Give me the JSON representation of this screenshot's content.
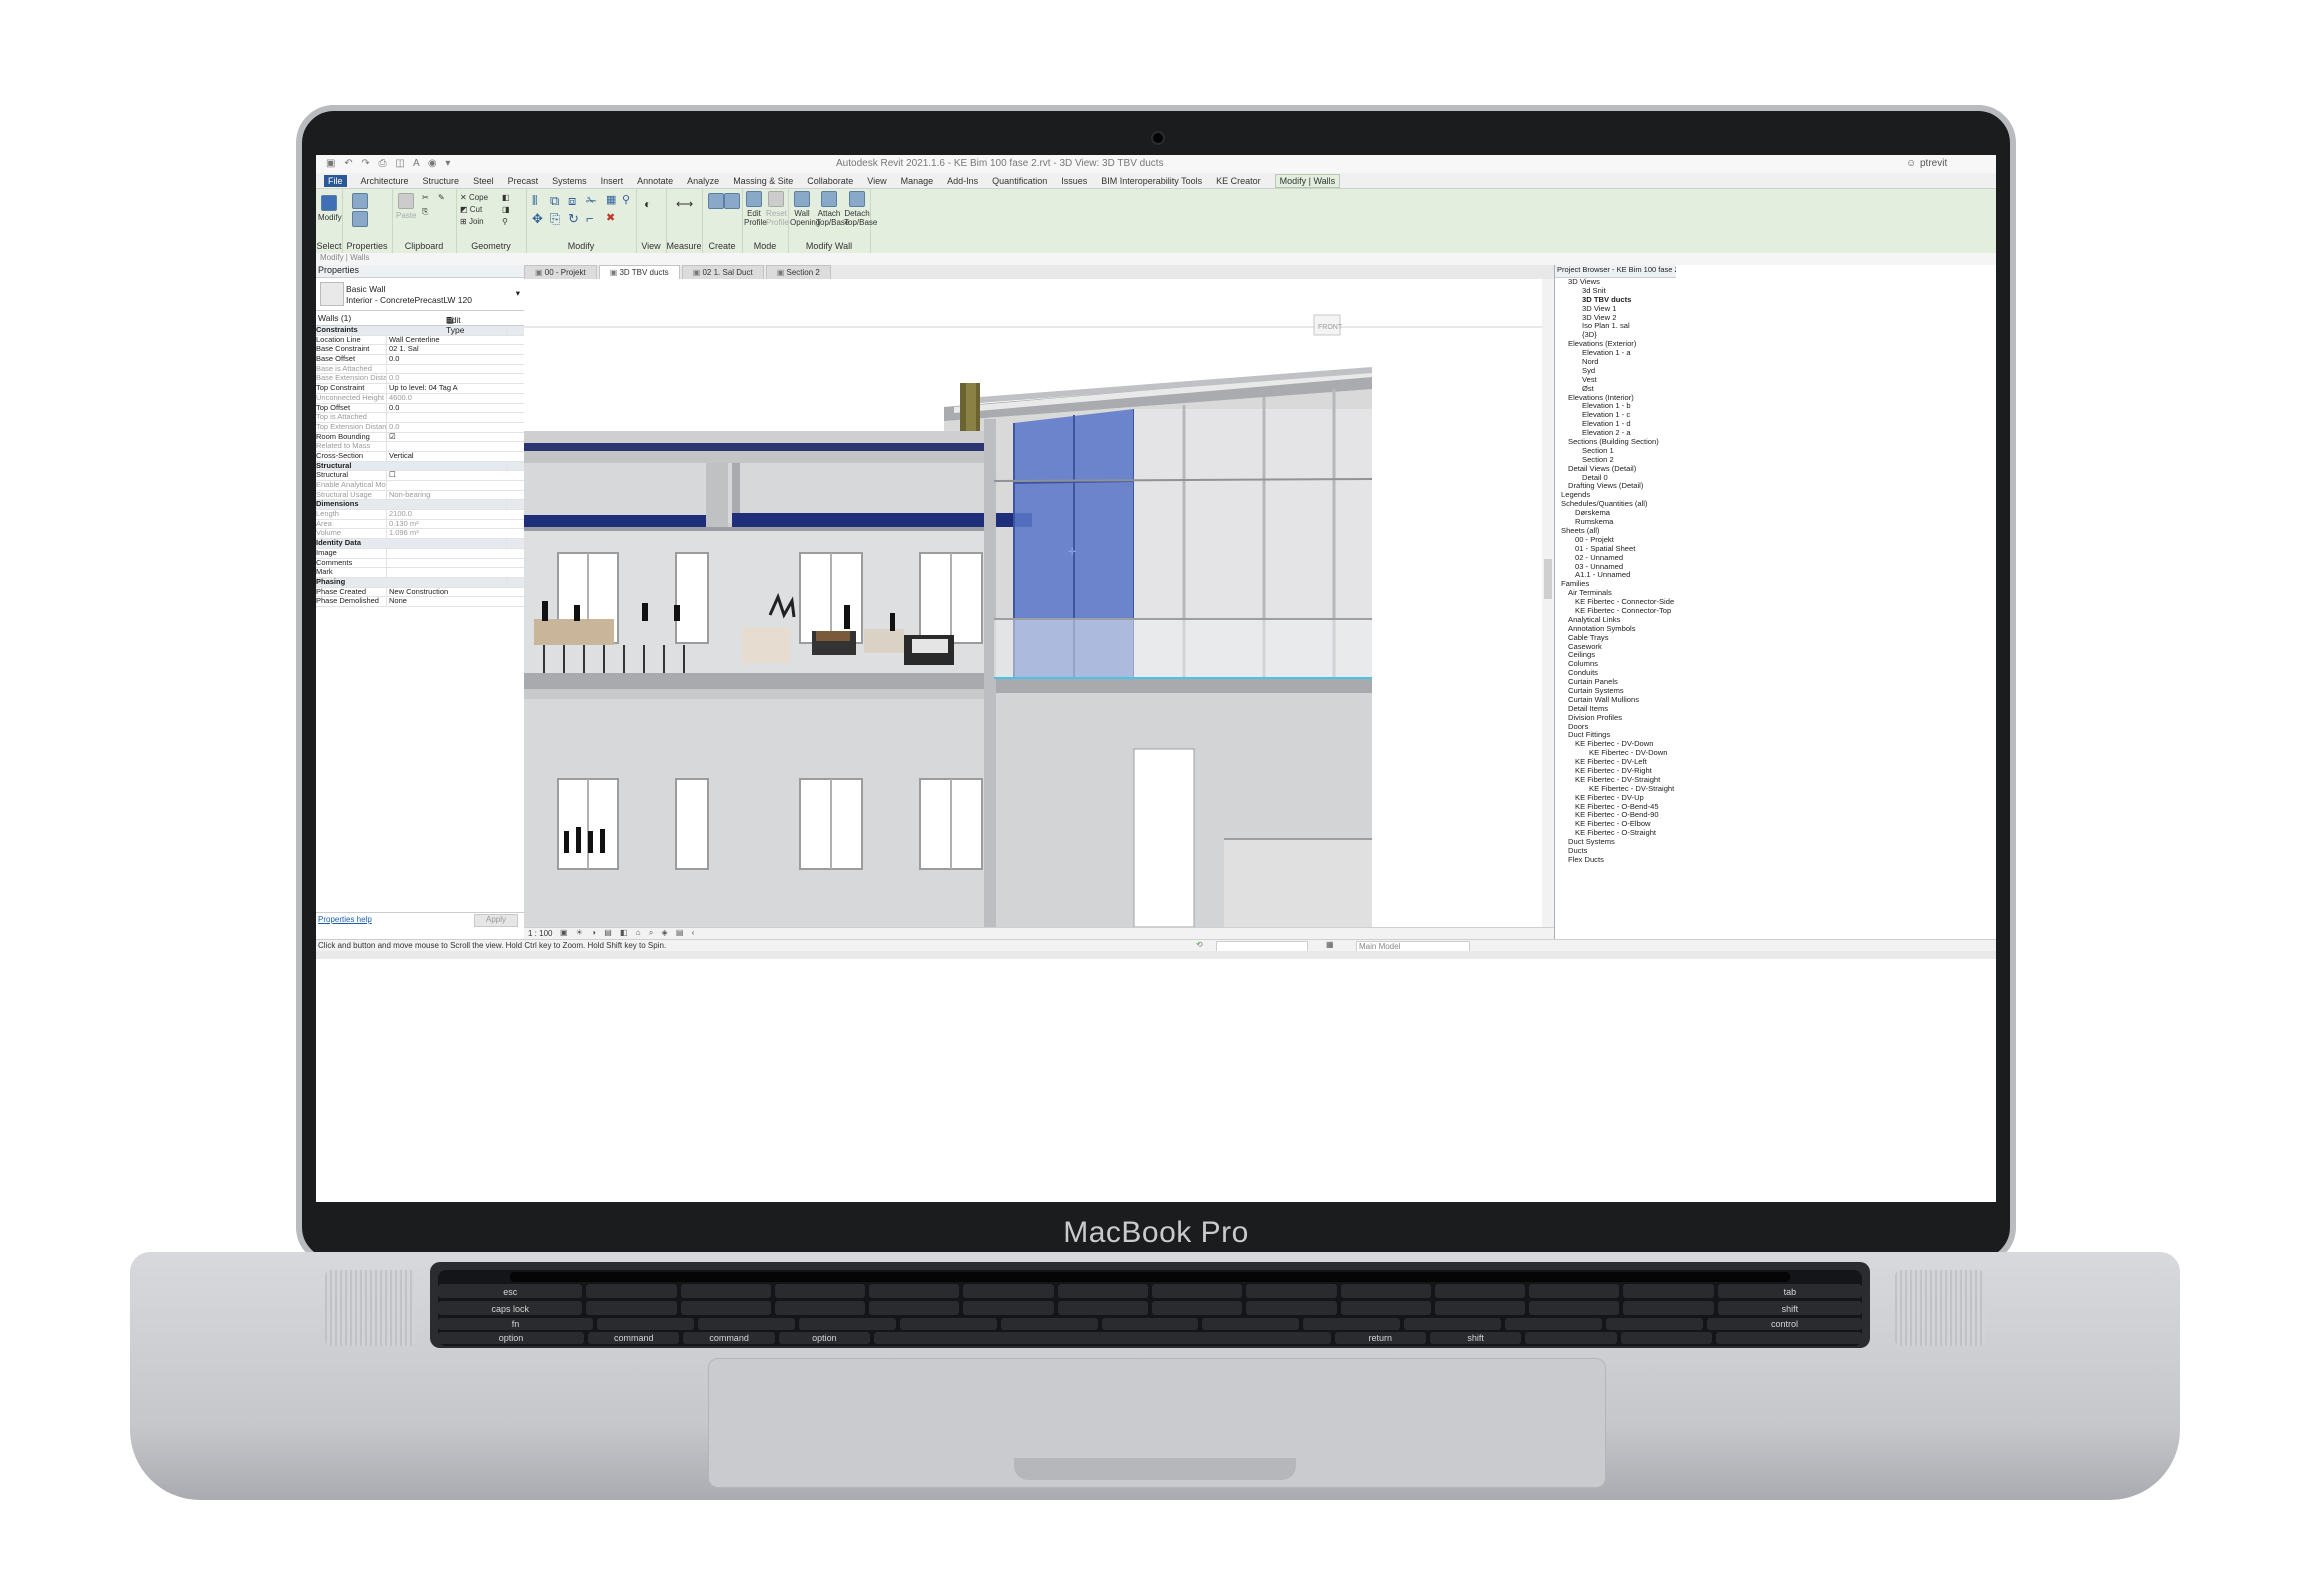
{
  "device": {
    "brand_label": "MacBook Pro"
  },
  "titlebar": {
    "title": "Autodesk Revit 2021.1.6 - KE Bim 100 fase 2.rvt - 3D View: 3D TBV ducts",
    "user": "ptrevit"
  },
  "ribbon_tabs": [
    "File",
    "Architecture",
    "Structure",
    "Steel",
    "Precast",
    "Systems",
    "Insert",
    "Annotate",
    "Analyze",
    "Massing & Site",
    "Collaborate",
    "View",
    "Manage",
    "Add-Ins",
    "Quantification",
    "Issues",
    "BIM Interoperability Tools",
    "KE Creator",
    "Modify | Walls"
  ],
  "ribbon": {
    "modify_button": "Modify",
    "select_label": "Select",
    "properties_label": "Properties",
    "clipboard_label": "Clipboard",
    "paste_label": "Paste",
    "cope_label": "Cope",
    "cut_label": "Cut",
    "join_label": "Join",
    "geometry_label": "Geometry",
    "modify_label": "Modify",
    "view_label": "View",
    "measure_label": "Measure",
    "create_label": "Create",
    "edit_profile": "Edit Profile",
    "reset_profile": "Reset Profile",
    "mode_label": "Mode",
    "wall_opening": "Wall Opening",
    "attach_topbase": "Attach Top/Base",
    "detach_topbase": "Detach Top/Base",
    "modify_wall_label": "Modify Wall"
  },
  "context_bar": "Modify | Walls",
  "properties": {
    "header": "Properties",
    "type_line1": "Basic Wall",
    "type_line2": "Interior - ConcretePrecastLW 120",
    "instance_filter": "Walls (1)",
    "edit_type": "Edit Type",
    "rows": [
      {
        "name": "Constraints",
        "value": "",
        "group": true
      },
      {
        "name": "Location Line",
        "value": "Wall Centerline"
      },
      {
        "name": "Base Constraint",
        "value": "02 1. Sal"
      },
      {
        "name": "Base Offset",
        "value": "0.0"
      },
      {
        "name": "Base is Attached",
        "value": "",
        "dim": true
      },
      {
        "name": "Base Extension Distance",
        "value": "0.0",
        "dim": true
      },
      {
        "name": "Top Constraint",
        "value": "Up to level: 04 Tag A"
      },
      {
        "name": "Unconnected Height",
        "value": "4600.0",
        "dim": true
      },
      {
        "name": "Top Offset",
        "value": "0.0"
      },
      {
        "name": "Top is Attached",
        "value": "",
        "dim": true
      },
      {
        "name": "Top Extension Distance",
        "value": "0.0",
        "dim": true
      },
      {
        "name": "Room Bounding",
        "value": "☑"
      },
      {
        "name": "Related to Mass",
        "value": "",
        "dim": true
      },
      {
        "name": "Cross-Section",
        "value": "Vertical"
      },
      {
        "name": "Structural",
        "value": "",
        "group": true
      },
      {
        "name": "Structural",
        "value": "☐"
      },
      {
        "name": "Enable Analytical Model",
        "value": "",
        "dim": true
      },
      {
        "name": "Structural Usage",
        "value": "Non-bearing",
        "dim": true
      },
      {
        "name": "Dimensions",
        "value": "",
        "group": true
      },
      {
        "name": "Length",
        "value": "2100.0",
        "dim": true
      },
      {
        "name": "Area",
        "value": "0.130 m²",
        "dim": true
      },
      {
        "name": "Volume",
        "value": "1.096 m³",
        "dim": true
      },
      {
        "name": "Identity Data",
        "value": "",
        "group": true
      },
      {
        "name": "Image",
        "value": ""
      },
      {
        "name": "Comments",
        "value": ""
      },
      {
        "name": "Mark",
        "value": ""
      },
      {
        "name": "Phasing",
        "value": "",
        "group": true
      },
      {
        "name": "Phase Created",
        "value": "New Construction"
      },
      {
        "name": "Phase Demolished",
        "value": "None"
      }
    ],
    "help_link": "Properties help",
    "apply_button": "Apply"
  },
  "view_tabs": [
    {
      "label": "00 - Projekt",
      "active": false
    },
    {
      "label": "3D TBV ducts",
      "active": true
    },
    {
      "label": "02 1. Sal Duct",
      "active": false
    },
    {
      "label": "Section 2",
      "active": false
    }
  ],
  "viewcube_label": "FRONT",
  "view_control": {
    "scale": "1 : 100"
  },
  "project_browser": {
    "header": "Project Browser - KE Bim 100 fase 2.rvt",
    "items": [
      {
        "label": "3D Views",
        "indent": 1
      },
      {
        "label": "3d Snit",
        "indent": 3
      },
      {
        "label": "3D TBV ducts",
        "indent": 3,
        "bold": true
      },
      {
        "label": "3D View 1",
        "indent": 3
      },
      {
        "label": "3D View 2",
        "indent": 3
      },
      {
        "label": "Iso Plan 1. sal",
        "indent": 3
      },
      {
        "label": "{3D}",
        "indent": 3
      },
      {
        "label": "Elevations (Exterior)",
        "indent": 1
      },
      {
        "label": "Elevation 1 - a",
        "indent": 3
      },
      {
        "label": "Nord",
        "indent": 3
      },
      {
        "label": "Syd",
        "indent": 3
      },
      {
        "label": "Vest",
        "indent": 3
      },
      {
        "label": "Øst",
        "indent": 3
      },
      {
        "label": "Elevations (Interior)",
        "indent": 1
      },
      {
        "label": "Elevation 1 - b",
        "indent": 3
      },
      {
        "label": "Elevation 1 - c",
        "indent": 3
      },
      {
        "label": "Elevation 1 - d",
        "indent": 3
      },
      {
        "label": "Elevation 2 - a",
        "indent": 3
      },
      {
        "label": "Sections (Building Section)",
        "indent": 1
      },
      {
        "label": "Section 1",
        "indent": 3
      },
      {
        "label": "Section 2",
        "indent": 3
      },
      {
        "label": "Detail Views (Detail)",
        "indent": 1
      },
      {
        "label": "Detail 0",
        "indent": 3
      },
      {
        "label": "Drafting Views (Detail)",
        "indent": 1
      },
      {
        "label": "Legends",
        "indent": 0
      },
      {
        "label": "Schedules/Quantities (all)",
        "indent": 0
      },
      {
        "label": "Dørskema",
        "indent": 2
      },
      {
        "label": "Rumskema",
        "indent": 2
      },
      {
        "label": "Sheets (all)",
        "indent": 0
      },
      {
        "label": "00 - Projekt",
        "indent": 2
      },
      {
        "label": "01 - Spatial Sheet",
        "indent": 2
      },
      {
        "label": "02 - Unnamed",
        "indent": 2
      },
      {
        "label": "03 - Unnamed",
        "indent": 2
      },
      {
        "label": "A1.1 - Unnamed",
        "indent": 2
      },
      {
        "label": "Families",
        "indent": 0
      },
      {
        "label": "Air Terminals",
        "indent": 1
      },
      {
        "label": "KE Fibertec - Connector-Side",
        "indent": 2
      },
      {
        "label": "KE Fibertec - Connector-Top",
        "indent": 2
      },
      {
        "label": "Analytical Links",
        "indent": 1
      },
      {
        "label": "Annotation Symbols",
        "indent": 1
      },
      {
        "label": "Cable Trays",
        "indent": 1
      },
      {
        "label": "Casework",
        "indent": 1
      },
      {
        "label": "Ceilings",
        "indent": 1
      },
      {
        "label": "Columns",
        "indent": 1
      },
      {
        "label": "Conduits",
        "indent": 1
      },
      {
        "label": "Curtain Panels",
        "indent": 1
      },
      {
        "label": "Curtain Systems",
        "indent": 1
      },
      {
        "label": "Curtain Wall Mullions",
        "indent": 1
      },
      {
        "label": "Detail Items",
        "indent": 1
      },
      {
        "label": "Division Profiles",
        "indent": 1
      },
      {
        "label": "Doors",
        "indent": 1
      },
      {
        "label": "Duct Fittings",
        "indent": 1
      },
      {
        "label": "KE Fibertec - DV-Down",
        "indent": 2
      },
      {
        "label": "KE Fibertec - DV-Down",
        "indent": 4
      },
      {
        "label": "KE Fibertec - DV-Left",
        "indent": 2
      },
      {
        "label": "KE Fibertec - DV-Right",
        "indent": 2
      },
      {
        "label": "KE Fibertec - DV-Straight",
        "indent": 2
      },
      {
        "label": "KE Fibertec - DV-Straight",
        "indent": 4
      },
      {
        "label": "KE Fibertec - DV-Up",
        "indent": 2
      },
      {
        "label": "KE Fibertec - O-Bend-45",
        "indent": 2
      },
      {
        "label": "KE Fibertec - O-Bend-90",
        "indent": 2
      },
      {
        "label": "KE Fibertec - O-Elbow",
        "indent": 2
      },
      {
        "label": "KE Fibertec - O-Straight",
        "indent": 2
      },
      {
        "label": "Duct Systems",
        "indent": 1
      },
      {
        "label": "Ducts",
        "indent": 1
      },
      {
        "label": "Flex Ducts",
        "indent": 1
      }
    ]
  },
  "statusbar": {
    "hint": "Click and button and move mouse to Scroll the view. Hold Ctrl key to Zoom. Hold Shift key to Spin.",
    "model": "Main Model"
  },
  "keyboard": {
    "row_labels": [
      "esc",
      "tab",
      "caps lock",
      "shift",
      "fn",
      "control",
      "option",
      "command",
      "command",
      "option",
      "return",
      "shift"
    ]
  },
  "colors": {
    "ribbon_bg": "#e4eedf",
    "curtain_wall_blue": "#5b78c8",
    "duct_navy": "#1f2e7a",
    "slab_gray": "#a8aaad"
  }
}
